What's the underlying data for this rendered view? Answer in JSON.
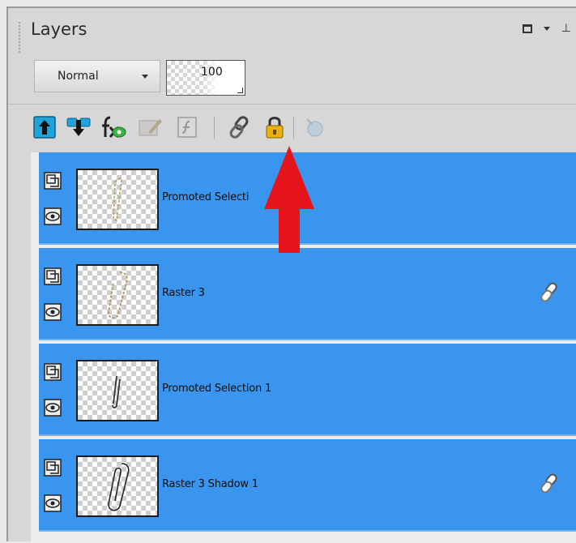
{
  "panel": {
    "title": "Layers"
  },
  "blend": {
    "mode": "Normal",
    "opacity": "100"
  },
  "toolbar": {
    "items": [
      {
        "icon": "move-layer-up-icon"
      },
      {
        "icon": "move-layer-down-icon"
      },
      {
        "icon": "layer-styles-icon"
      },
      {
        "icon": "edit-selection-icon"
      },
      {
        "icon": "layer-script-icon"
      },
      {
        "icon": "link-layers-icon"
      },
      {
        "icon": "lock-layer-icon"
      },
      {
        "icon": "highlight-layer-icon"
      }
    ]
  },
  "layers": [
    {
      "name": "Promoted Selecti",
      "linked": false,
      "selected": true,
      "thumb": "dashed-clip"
    },
    {
      "name": "Raster 3",
      "linked": true,
      "selected": true,
      "thumb": "dashed-clip-large"
    },
    {
      "name": "Promoted Selection 1",
      "linked": false,
      "selected": true,
      "thumb": "clip"
    },
    {
      "name": "Raster 3 Shadow 1",
      "linked": true,
      "selected": true,
      "thumb": "clip-outline"
    }
  ],
  "colors": {
    "selected_layer": "#3a95ee",
    "annotation_arrow": "#e8141b",
    "lock": "#e9b20e"
  }
}
